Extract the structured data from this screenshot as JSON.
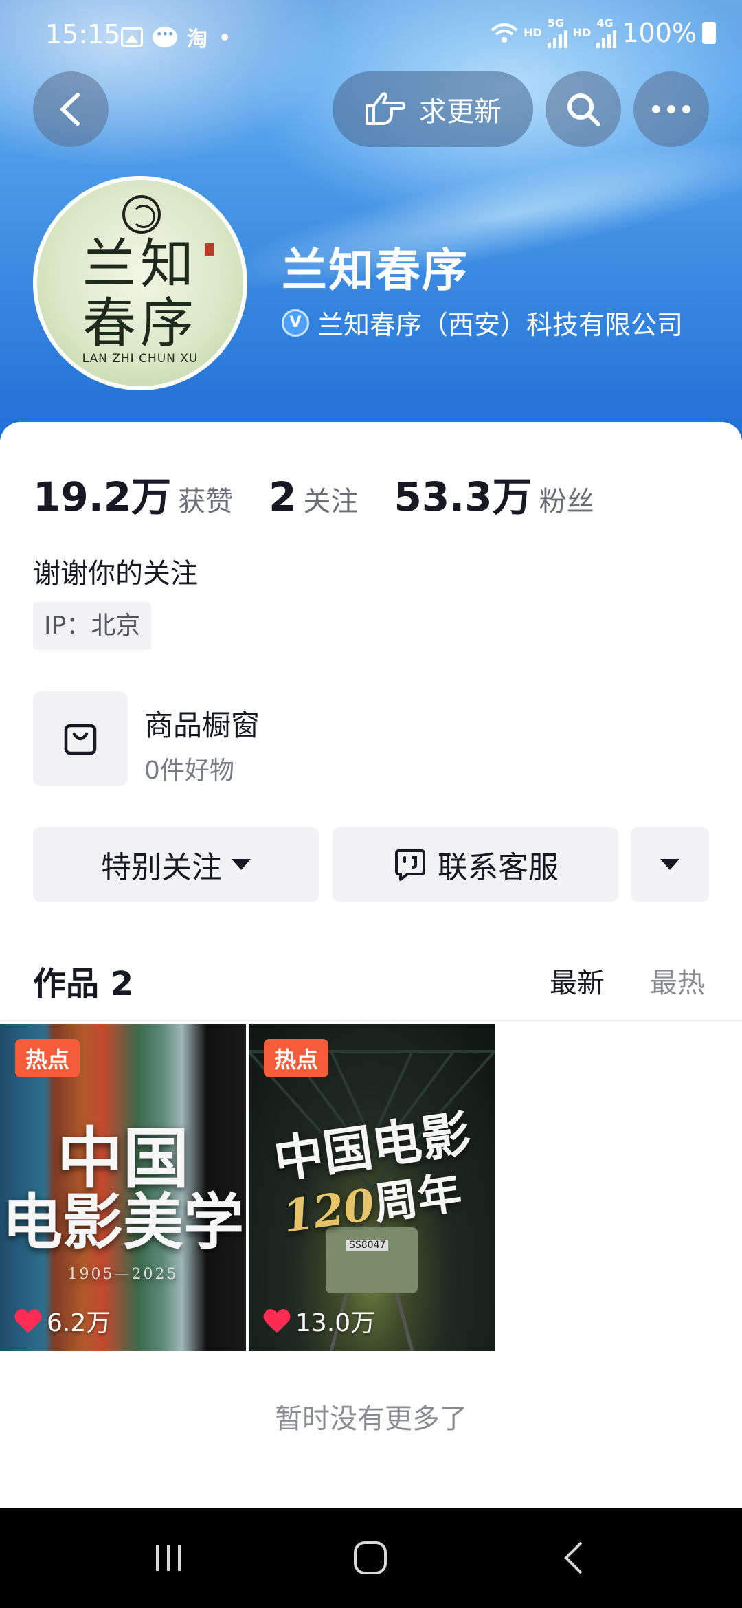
{
  "status_bar": {
    "time": "15:15",
    "notif_tao": "淘",
    "hd1": "HD",
    "g5": "5G",
    "hd2": "HD",
    "g4": "4G",
    "battery": "100%"
  },
  "top_bar": {
    "update_label": "求更新"
  },
  "profile": {
    "name": "兰知春序",
    "verified_company": "兰知春序（西安）科技有限公司",
    "verify_mark": "V",
    "avatar_text_line1": "兰知",
    "avatar_text_line2": "春序",
    "avatar_roman": "LAN ZHI CHUN XU"
  },
  "stats": {
    "likes_value": "19.2万",
    "likes_label": "获赞",
    "following_value": "2",
    "following_label": "关注",
    "fans_value": "53.3万",
    "fans_label": "粉丝"
  },
  "bio": "谢谢你的关注",
  "ip_tag": "IP：北京",
  "shop": {
    "title": "商品橱窗",
    "subtitle": "0件好物"
  },
  "actions": {
    "follow_label": "特别关注",
    "contact_label": "联系客服"
  },
  "works": {
    "title": "作品 2",
    "sort_new": "最新",
    "sort_hot": "最热",
    "items": [
      {
        "badge": "热点",
        "title_line1": "中国",
        "title_line2": "电影美学",
        "years": "1905—2025",
        "likes": "6.2万"
      },
      {
        "badge": "热点",
        "title_line1": "中国电影",
        "title_line2_num": "120",
        "title_line2_text": "周年",
        "likes": "13.0万"
      }
    ]
  },
  "footer_text": "暂时没有更多了",
  "colors": {
    "header_blue": "#3f8fe3",
    "hot_badge": "#f55c3a",
    "heart": "#fe2c55",
    "verify_blue": "#4f9fff"
  }
}
